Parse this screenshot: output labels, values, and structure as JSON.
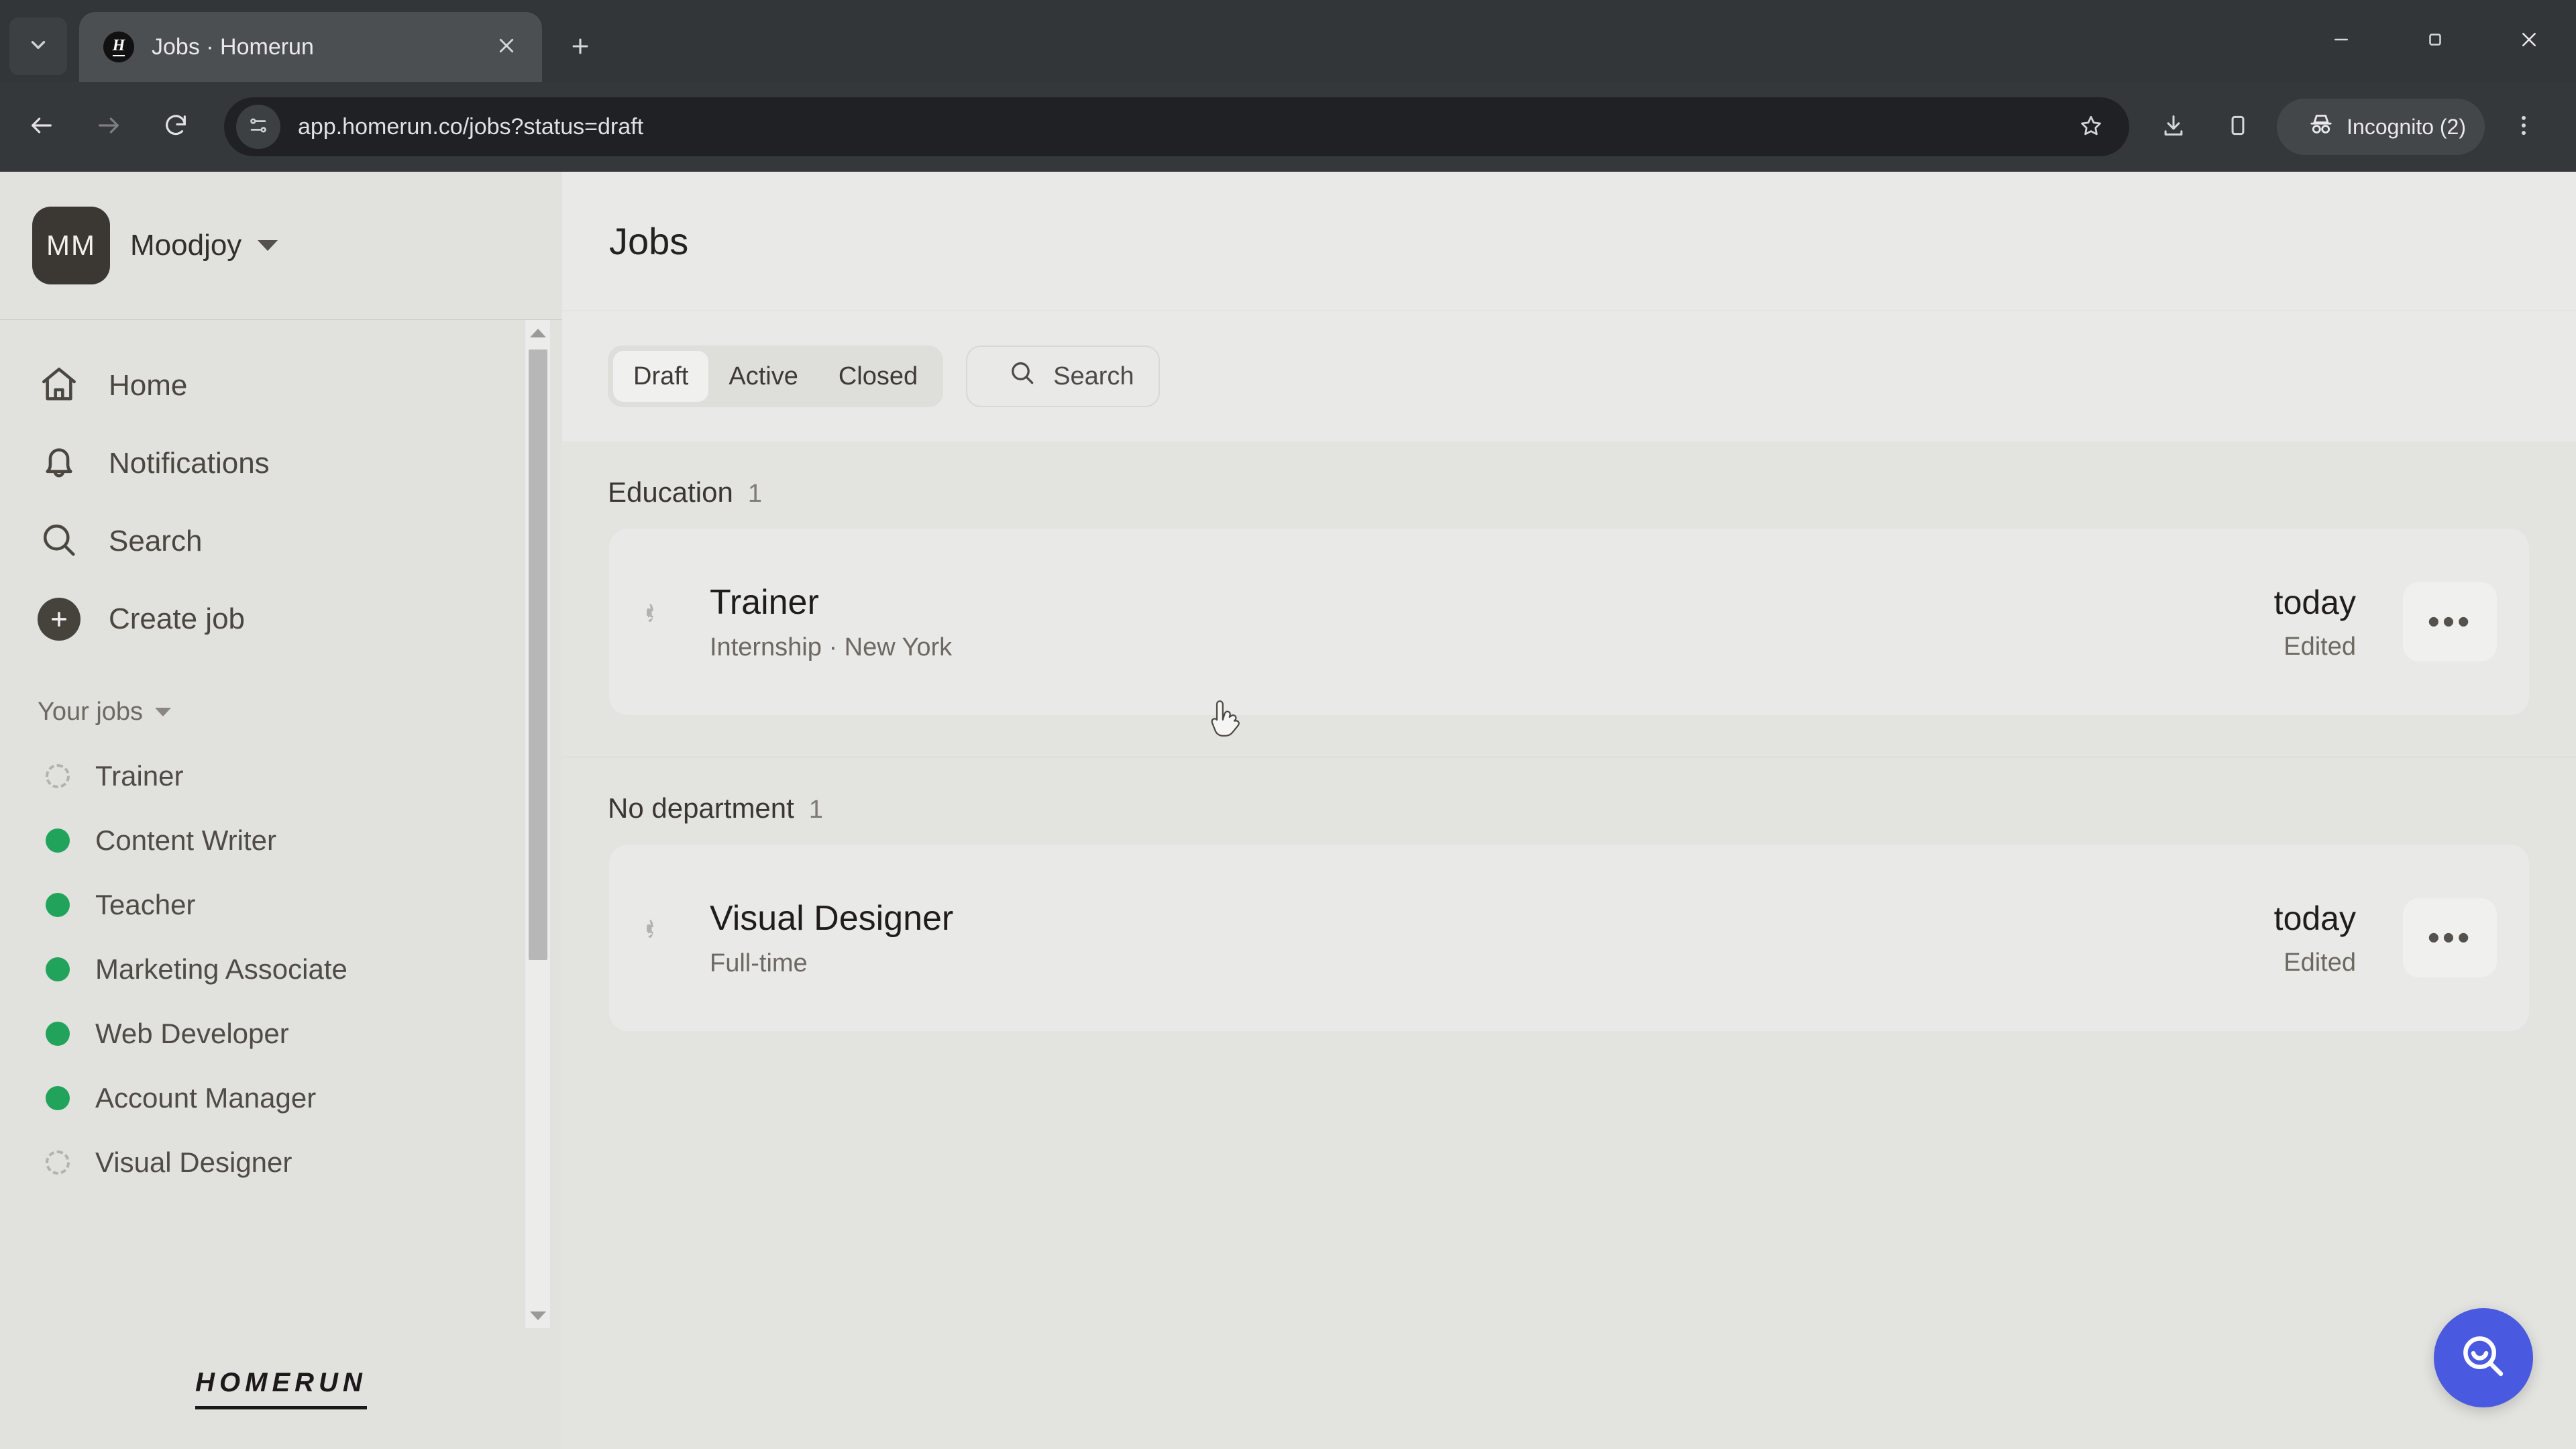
{
  "browser": {
    "tab": {
      "title": "Jobs · Homerun",
      "favicon_letter": "H",
      "favicon_name": "homerun-favicon"
    },
    "new_tab_label": "+",
    "url": "app.homerun.co/jobs?status=draft",
    "profile_chip": "Incognito (2)",
    "icons": {
      "tab_list": "tab-search-icon",
      "close_tab": "close-icon",
      "back": "back-arrow-icon",
      "forward": "forward-arrow-icon",
      "reload": "reload-icon",
      "site_info": "site-settings-icon",
      "bookmark": "star-icon",
      "downloads": "download-icon",
      "side_panel": "side-panel-icon",
      "incognito": "incognito-icon",
      "menu": "three-dot-menu-icon",
      "minimize": "minimize-icon",
      "maximize": "maximize-icon",
      "window_close": "window-close-icon"
    }
  },
  "sidebar": {
    "org": {
      "initials": "MM",
      "name": "Moodjoy"
    },
    "nav": [
      {
        "label": "Home",
        "icon": "home-icon"
      },
      {
        "label": "Notifications",
        "icon": "bell-icon"
      },
      {
        "label": "Search",
        "icon": "search-icon"
      },
      {
        "label": "Create job",
        "icon": "plus-circle-icon"
      }
    ],
    "jobs_section_label": "Your jobs",
    "jobs": [
      {
        "label": "Trainer",
        "status": "draft"
      },
      {
        "label": "Content Writer",
        "status": "active"
      },
      {
        "label": "Teacher",
        "status": "active"
      },
      {
        "label": "Marketing Associate",
        "status": "active"
      },
      {
        "label": "Web Developer",
        "status": "active"
      },
      {
        "label": "Account Manager",
        "status": "active"
      },
      {
        "label": "Visual Designer",
        "status": "draft"
      }
    ],
    "footer_logo": "HOMERUN"
  },
  "main": {
    "title": "Jobs",
    "tabs": [
      {
        "label": "Draft",
        "active": true
      },
      {
        "label": "Active",
        "active": false
      },
      {
        "label": "Closed",
        "active": false
      }
    ],
    "search": {
      "label": "Search",
      "icon": "search-icon"
    },
    "groups": [
      {
        "name": "Education",
        "count": "1",
        "jobs": [
          {
            "title": "Trainer",
            "subtitle": "Internship · New York",
            "date": "today",
            "edited": "Edited",
            "status": "draft",
            "more_label": "•••"
          }
        ]
      },
      {
        "name": "No department",
        "count": "1",
        "jobs": [
          {
            "title": "Visual Designer",
            "subtitle": "Full-time",
            "date": "today",
            "edited": "Edited",
            "status": "draft",
            "more_label": "•••"
          }
        ]
      }
    ],
    "help_fab": {
      "icon": "search-smile-icon"
    }
  },
  "colors": {
    "accent_blue": "#4a5ae0",
    "status_active_green": "#22a35c",
    "app_background": "#e3e3df",
    "sidebar_background": "#e1e1dd",
    "card_background": "#e9e9e7",
    "browser_chrome": "#35383b"
  }
}
